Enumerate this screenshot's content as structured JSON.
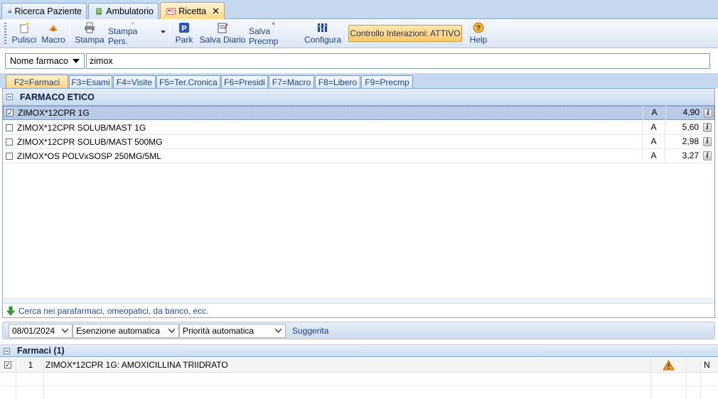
{
  "tabs": [
    {
      "label": "Ricerca Paziente",
      "icon": "patients-icon",
      "active": false
    },
    {
      "label": "Ambulatorio",
      "icon": "ambulatorio-icon",
      "active": false
    },
    {
      "label": "Ricetta",
      "icon": "prescription-icon",
      "active": true,
      "close": "✕"
    }
  ],
  "toolbar": {
    "pulisci": "Pulisci",
    "macro": "Macro",
    "stampa": "Stampa",
    "stampa_pers": "Stampa Pers.",
    "park": "Park",
    "salva_diario": "Salva Diario",
    "salva_precmp": "Salva Precmp",
    "configura": "Configura",
    "controllo": "Controllo Interazioni: ATTIVO",
    "help": "Help"
  },
  "search": {
    "mode": "Nome farmaco",
    "value": "zimox"
  },
  "ftabs": [
    "F2=Farmaci",
    "F3=Esami",
    "F4=Visite",
    "F5=Ter.Cronica",
    "F6=Presidi",
    "F7=Macro",
    "F8=Libero",
    "F9=Precmp"
  ],
  "group": {
    "title": "FARMACO ETICO"
  },
  "drugs": [
    {
      "name": "ZIMOX*12CPR 1G",
      "cls": "A",
      "price": "4,90",
      "checked": true,
      "selected": true
    },
    {
      "name": "ZIMOX*12CPR SOLUB/MAST 1G",
      "cls": "A",
      "price": "5,60",
      "checked": false,
      "selected": false
    },
    {
      "name": "ZIMOX*12CPR SOLUB/MAST 500MG",
      "cls": "A",
      "price": "2,98",
      "checked": false,
      "selected": false
    },
    {
      "name": "ZIMOX*OS POLVxSOSP 250MG/5ML",
      "cls": "A",
      "price": "3,27",
      "checked": false,
      "selected": false
    }
  ],
  "link_text": "Cerca nei parafarmaci, omeopatici, da banco, ecc.",
  "options": {
    "date": "08/01/2024",
    "esenzione": "Esenzione automatica",
    "priorita": "Priorità automatica",
    "suggerita": "Suggerita"
  },
  "prescription": {
    "title": "Farmaci (1)",
    "rows": [
      {
        "num": "1",
        "text": "ZIMOX*12CPR 1G: AMOXICILLINA TRIIDRATO",
        "flag": "N"
      }
    ]
  },
  "colors": {
    "accent": "#ffc866",
    "selection": "#b9cbe6",
    "link": "#1f4c99"
  }
}
